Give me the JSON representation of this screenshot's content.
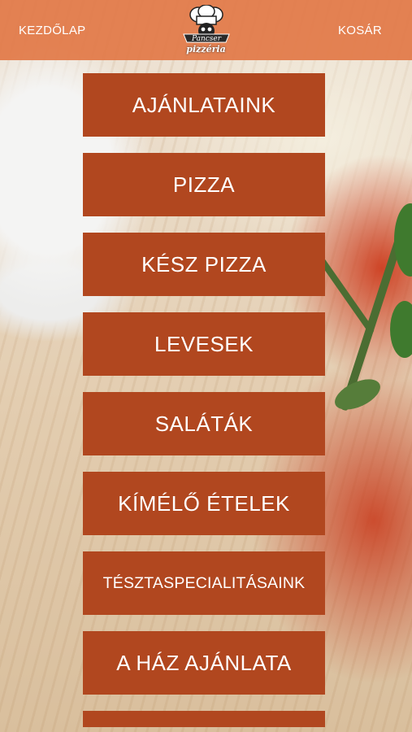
{
  "header": {
    "home_label": "KEZDŐLAP",
    "cart_label": "KOSÁR",
    "logo": {
      "brand_text": "Pancser",
      "sub_text": "pizzéria",
      "icon": "chef-hat-icon"
    }
  },
  "menu": {
    "items": [
      {
        "label": "AJÁNLATAINK"
      },
      {
        "label": "PIZZA"
      },
      {
        "label": "KÉSZ PIZZA"
      },
      {
        "label": "LEVESEK"
      },
      {
        "label": "SALÁTÁK"
      },
      {
        "label": "KÍMÉLŐ ÉTELEK"
      },
      {
        "label": "TÉSZTASPECIALITÁSAINK"
      },
      {
        "label": "A HÁZ AJÁNLATA"
      },
      {
        "label": ""
      }
    ]
  },
  "colors": {
    "header_bg": "#e2784a",
    "button_bg": "#b1471f",
    "button_text": "#ffffff"
  }
}
